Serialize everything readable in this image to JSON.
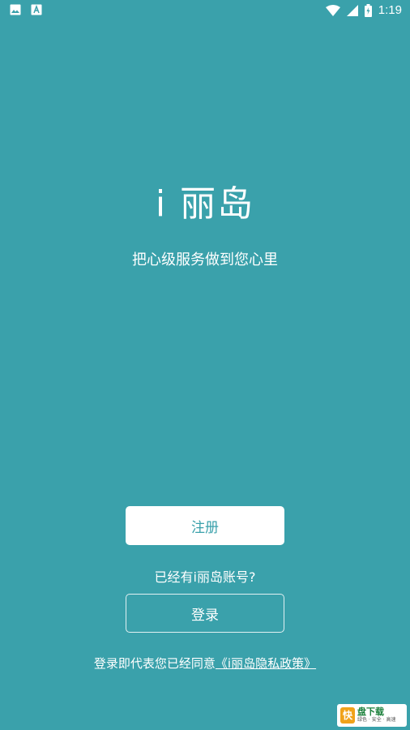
{
  "status_bar": {
    "time": "1:19",
    "icons": [
      "image-icon",
      "a-box-icon",
      "wifi-icon",
      "signal-icon",
      "battery-charging-icon"
    ]
  },
  "app": {
    "title": "i 丽岛",
    "slogan": "把心级服务做到您心里"
  },
  "actions": {
    "register_label": "注册",
    "has_account_text": "已经有i丽岛账号?",
    "login_label": "登录"
  },
  "privacy": {
    "prefix": "登录即代表您已经同意",
    "link_text": "《i丽岛隐私政策》"
  },
  "watermark": {
    "logo_char": "快",
    "main_text": "盘下载",
    "sub_text": "绿色 · 安全 · 高速"
  },
  "colors": {
    "background": "#3aa1ab",
    "primary_text": "#ffffff",
    "button_text": "#3aa1ab"
  }
}
